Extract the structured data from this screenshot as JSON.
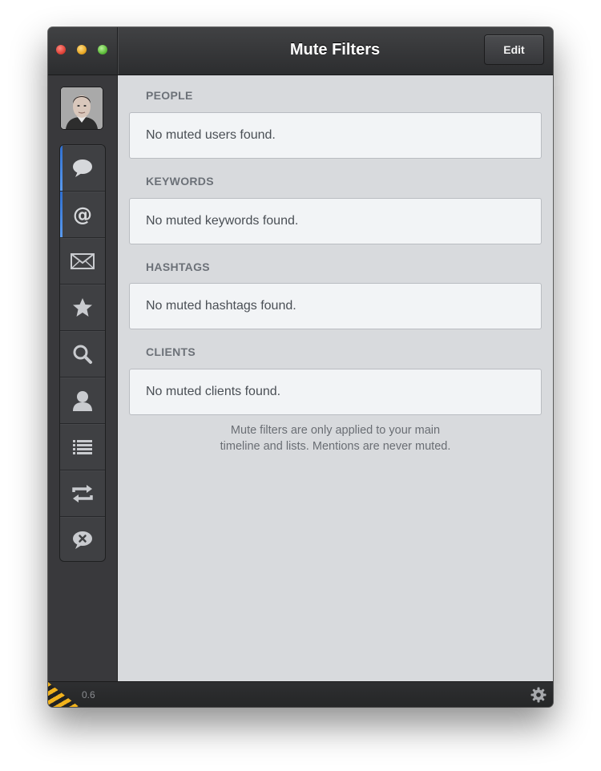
{
  "window": {
    "title": "Mute Filters",
    "edit_label": "Edit"
  },
  "sidebar": {
    "items": [
      {
        "icon": "speech-bubble-icon",
        "label": "Timeline",
        "active": true
      },
      {
        "icon": "at-sign-icon",
        "label": "Mentions",
        "active": true
      },
      {
        "icon": "envelope-icon",
        "label": "Messages",
        "active": false
      },
      {
        "icon": "star-icon",
        "label": "Favorites",
        "active": false
      },
      {
        "icon": "search-icon",
        "label": "Search",
        "active": false
      },
      {
        "icon": "person-icon",
        "label": "Profile",
        "active": false
      },
      {
        "icon": "list-icon",
        "label": "Lists",
        "active": false
      },
      {
        "icon": "retweet-icon",
        "label": "Retweets",
        "active": false
      },
      {
        "icon": "muted-bubble-icon",
        "label": "Mute Filters",
        "active": false
      }
    ]
  },
  "sections": [
    {
      "heading": "PEOPLE",
      "empty_text": "No muted users found."
    },
    {
      "heading": "KEYWORDS",
      "empty_text": "No muted keywords found."
    },
    {
      "heading": "HASHTAGS",
      "empty_text": "No muted hashtags found."
    },
    {
      "heading": "CLIENTS",
      "empty_text": "No muted clients found."
    }
  ],
  "footnote": {
    "line1": "Mute filters are only applied to your main",
    "line2": "timeline and lists. Mentions are never muted."
  },
  "statusbar": {
    "version": "0.6"
  },
  "colors": {
    "accent": "#3b7fe0",
    "hazard": "#f1b21c"
  }
}
